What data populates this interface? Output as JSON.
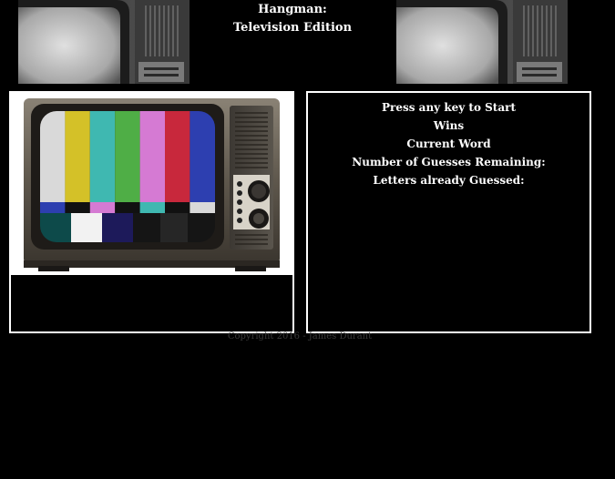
{
  "title": {
    "line1": "Hangman:",
    "line2": "Television Edition"
  },
  "game": {
    "start_prompt": "Press any key to Start",
    "wins_label": "Wins",
    "current_word_label": "Current Word",
    "guesses_remaining_label": "Number of Guesses Remaining:",
    "letters_guessed_label": "Letters already Guessed:"
  },
  "footer": {
    "copyright": "Copyright 2016 - James Durant"
  },
  "colors": {
    "background": "#000000",
    "text": "#ffffff",
    "border": "#ffffff",
    "copyright_text": "#3a3a3a"
  },
  "images": {
    "header_left": "vintage-tv-closeup-icon",
    "header_right": "vintage-tv-closeup-icon",
    "main_tv": "color-bars-television-icon"
  }
}
